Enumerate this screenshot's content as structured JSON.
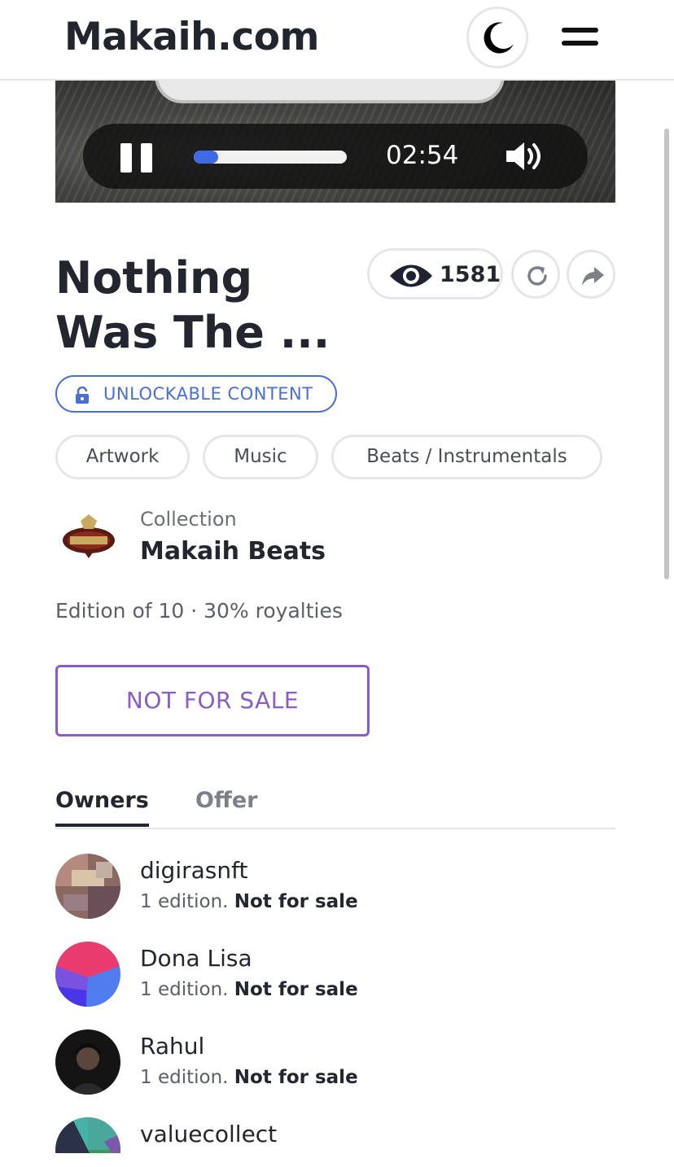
{
  "header": {
    "logo": "Makaih.com",
    "theme_icon": "moon-icon",
    "menu_icon": "hamburger-icon"
  },
  "player": {
    "time": "02:54",
    "progress": 0.16,
    "pause_icon": "pause-icon",
    "volume_icon": "volume-icon",
    "accent": "#3f6ae6"
  },
  "item": {
    "title": "Nothing Was The ...",
    "views": "1581",
    "unlock_label": "UNLOCKABLE CONTENT",
    "tags": [
      "Artwork",
      "Music",
      "Beats / Instrumentals"
    ]
  },
  "collection": {
    "caption": "Collection",
    "name": "Makaih Beats"
  },
  "edition_text": "Edition of 10 · 30% royalties",
  "sale_button": "NOT FOR SALE",
  "tabs": [
    "Owners",
    "Offer"
  ],
  "owners": [
    {
      "name": "digirasnft",
      "editions": "1 edition.",
      "status": "Not for sale"
    },
    {
      "name": "Dona Lisa",
      "editions": "1 edition.",
      "status": "Not for sale"
    },
    {
      "name": "Rahul",
      "editions": "1 edition.",
      "status": "Not for sale"
    },
    {
      "name": "valuecollect",
      "editions": "",
      "status": ""
    }
  ],
  "colors": {
    "unlock": "#4a6fd8",
    "sale": "#8a5cc6",
    "text": "#23252f"
  }
}
